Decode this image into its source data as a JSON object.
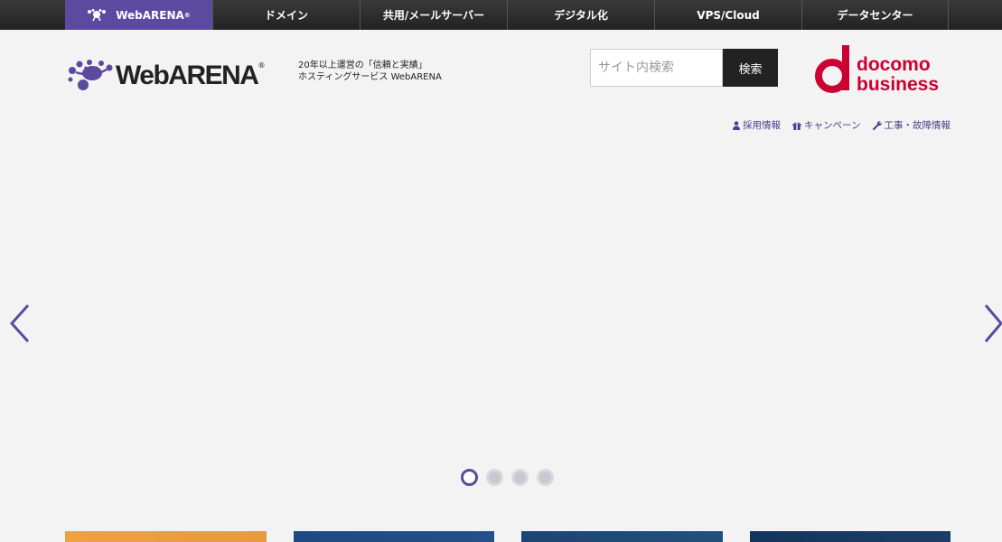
{
  "topnav": {
    "tabs": [
      {
        "label": "WebARENA",
        "reg": "®"
      },
      {
        "label": "ドメイン"
      },
      {
        "label": "共用/メールサーバー"
      },
      {
        "label": "デジタル化"
      },
      {
        "label": "VPS/Cloud"
      },
      {
        "label": "データセンター"
      }
    ]
  },
  "header": {
    "logo_text": "WebARENA",
    "logo_reg": "®",
    "tagline_line1": "20年以上運営の「信頼と実績」",
    "tagline_line2": "ホスティングサービス WebARENA",
    "search_placeholder": "サイト内検索",
    "search_button": "検索",
    "docomo_line1": "docomo",
    "docomo_line2": "business"
  },
  "util_links": [
    {
      "label": "採用情報",
      "icon": "user-icon"
    },
    {
      "label": "キャンペーン",
      "icon": "gift-icon"
    },
    {
      "label": "工事・故障情報",
      "icon": "wrench-icon"
    }
  ],
  "carousel": {
    "slide_count": 4,
    "active_slide": 1
  },
  "colors": {
    "brand_purple": "#5b4aa0",
    "docomo_red": "#cc0033",
    "nav_bg": "#2b2b2b"
  }
}
